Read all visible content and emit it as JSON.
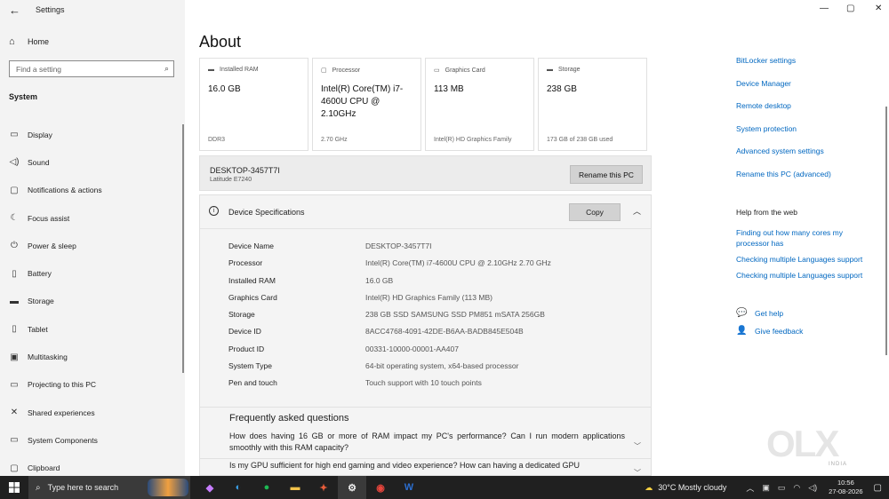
{
  "window": {
    "title": "Settings"
  },
  "sidebar": {
    "home": "Home",
    "search_placeholder": "Find a setting",
    "section": "System",
    "items": [
      {
        "label": "Display",
        "icon": "display-icon"
      },
      {
        "label": "Sound",
        "icon": "sound-icon"
      },
      {
        "label": "Notifications & actions",
        "icon": "notifications-icon"
      },
      {
        "label": "Focus assist",
        "icon": "moon-icon"
      },
      {
        "label": "Power & sleep",
        "icon": "power-icon"
      },
      {
        "label": "Battery",
        "icon": "battery-icon"
      },
      {
        "label": "Storage",
        "icon": "storage-icon"
      },
      {
        "label": "Tablet",
        "icon": "tablet-icon"
      },
      {
        "label": "Multitasking",
        "icon": "multitasking-icon"
      },
      {
        "label": "Projecting to this PC",
        "icon": "projecting-icon"
      },
      {
        "label": "Shared experiences",
        "icon": "shared-icon"
      },
      {
        "label": "System Components",
        "icon": "components-icon"
      },
      {
        "label": "Clipboard",
        "icon": "clipboard-icon"
      }
    ]
  },
  "main": {
    "title": "About",
    "cards": [
      {
        "header": "Installed RAM",
        "value": "16.0 GB",
        "sub": "DDR3",
        "icon": "ram-icon"
      },
      {
        "header": "Processor",
        "value": "Intel(R) Core(TM) i7-4600U CPU @ 2.10GHz",
        "sub": "2.70 GHz",
        "icon": "processor-icon"
      },
      {
        "header": "Graphics Card",
        "value": "113 MB",
        "sub": "Intel(R) HD Graphics Family",
        "icon": "graphics-icon"
      },
      {
        "header": "Storage",
        "value": "238 GB",
        "sub": "173 GB of 238 GB used",
        "icon": "storage-icon"
      }
    ],
    "pc": {
      "name": "DESKTOP-3457T7I",
      "model": "Latitude E7240",
      "rename_label": "Rename this PC"
    },
    "specs": {
      "title": "Device Specifications",
      "copy_label": "Copy",
      "rows": [
        {
          "key": "Device Name",
          "value": "DESKTOP-3457T7I"
        },
        {
          "key": "Processor",
          "value": "Intel(R) Core(TM) i7-4600U CPU @ 2.10GHz   2.70 GHz"
        },
        {
          "key": "Installed RAM",
          "value": "16.0 GB"
        },
        {
          "key": "Graphics Card",
          "value": "Intel(R) HD Graphics Family (113 MB)"
        },
        {
          "key": "Storage",
          "value": "238 GB SSD SAMSUNG SSD PM851 mSATA 256GB"
        },
        {
          "key": "Device ID",
          "value": "8ACC4768-4091-42DE-B6AA-BADB845E504B"
        },
        {
          "key": "Product ID",
          "value": "00331-10000-00001-AA407"
        },
        {
          "key": "System Type",
          "value": "64-bit operating system, x64-based processor"
        },
        {
          "key": "Pen and touch",
          "value": "Touch support with 10 touch points"
        }
      ]
    },
    "faq": {
      "title": "Frequently asked questions",
      "q1": "How does having 16 GB or more of RAM impact my PC's performance? Can I run modern applications smoothly with this RAM capacity?",
      "q2": "Is my GPU sufficient for high end gaming and video experience? How can having a dedicated GPU"
    }
  },
  "right_panel": {
    "links": [
      "BitLocker settings",
      "Device Manager",
      "Remote desktop",
      "System protection",
      "Advanced system settings",
      "Rename this PC (advanced)"
    ],
    "help_heading": "Help from the web",
    "web_links": [
      "Finding out how many cores my processor has",
      "Checking multiple Languages support",
      "Checking multiple Languages support"
    ],
    "get_help": "Get help",
    "give_feedback": "Give feedback"
  },
  "watermark": {
    "brand": "OLX",
    "sub": "INDIA"
  },
  "taskbar": {
    "search_placeholder": "Type here to search",
    "weather": "30°C  Mostly cloudy",
    "time": "10:56",
    "date": "27-08-2026",
    "apps": [
      "copilot-icon",
      "edge-icon",
      "spotify-icon",
      "file-explorer-icon",
      "app-icon",
      "settings-icon",
      "chrome-icon",
      "word-icon"
    ]
  },
  "colors": {
    "link": "#0067c0",
    "taskbar": "#202020",
    "sidebar": "#f3f3f3"
  }
}
